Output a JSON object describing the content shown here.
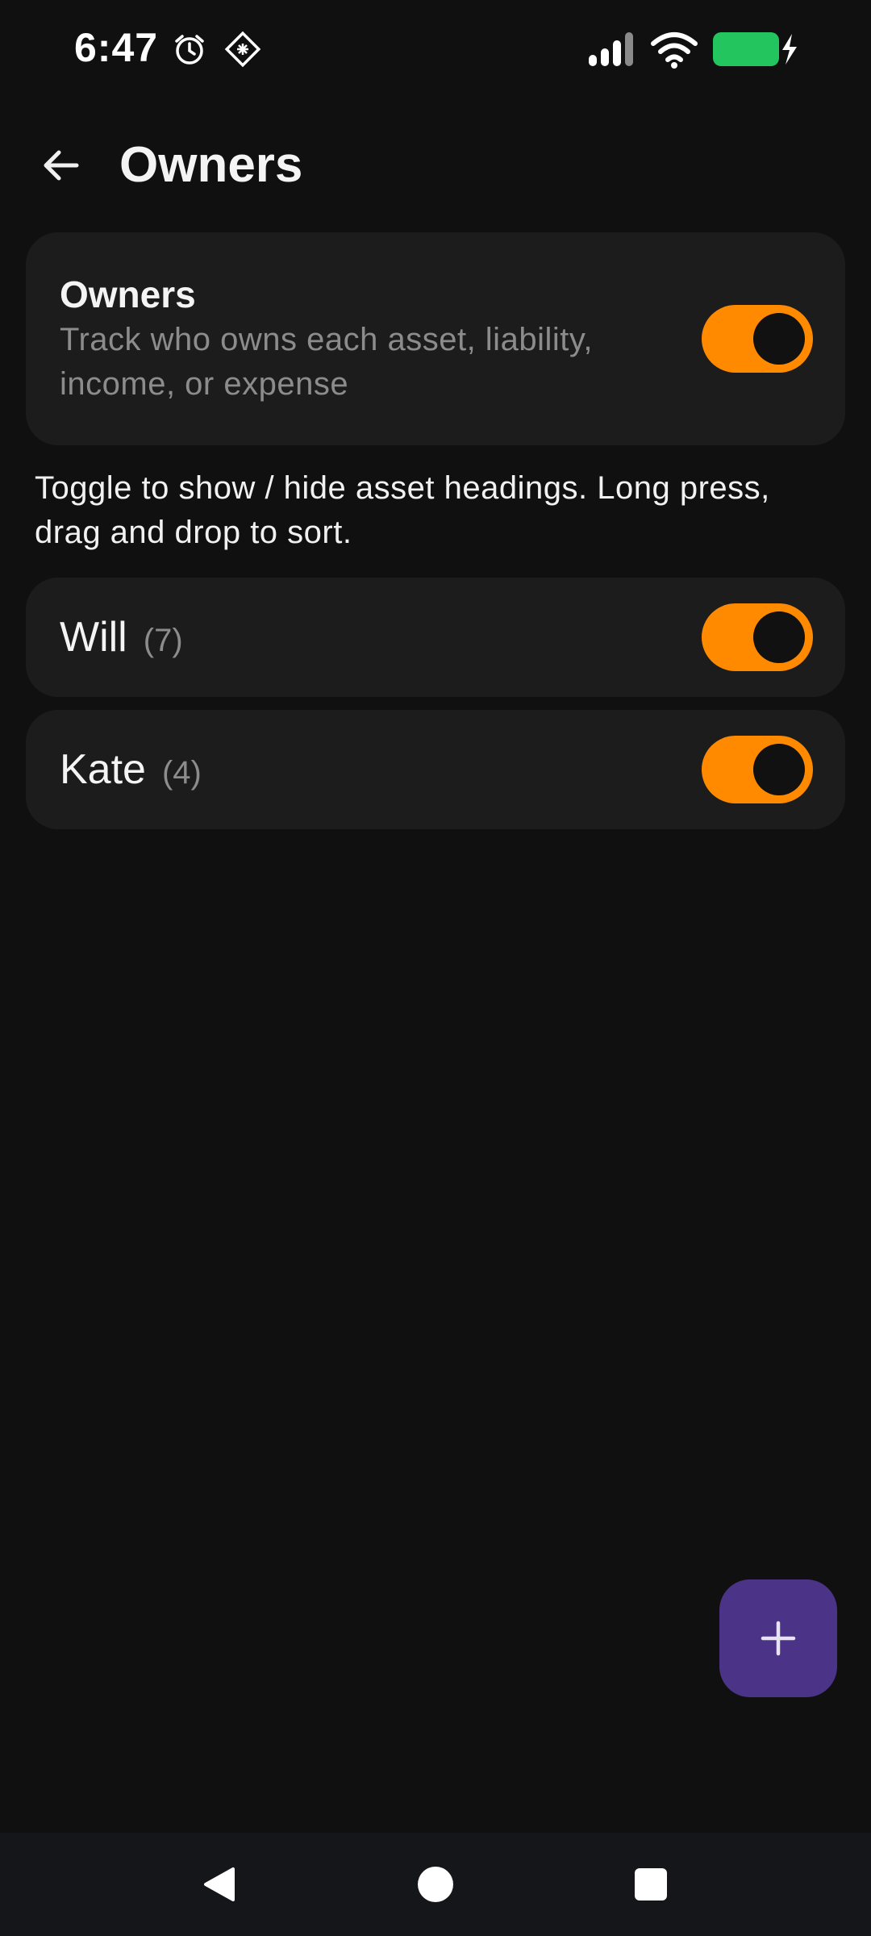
{
  "status_bar": {
    "time": "6:47",
    "icons": [
      "alarm-icon",
      "app-notification-icon",
      "signal-icon",
      "wifi-icon",
      "battery-charging-icon"
    ],
    "battery_color": "#22c55e"
  },
  "app_bar": {
    "back_icon": "arrow-left-icon",
    "title": "Owners"
  },
  "owners_card": {
    "title": "Owners",
    "description": "Track who owns each asset, liability, income, or expense",
    "enabled": true
  },
  "hint": "Toggle to show / hide asset headings. Long press, drag and drop to sort.",
  "owners": [
    {
      "name": "Will",
      "count": "(7)",
      "visible": true
    },
    {
      "name": "Kate",
      "count": "(4)",
      "visible": true
    }
  ],
  "fab": {
    "icon": "plus-icon"
  },
  "nav_bar": {
    "icons": [
      "back-triangle-icon",
      "home-circle-icon",
      "recents-square-icon"
    ]
  },
  "colors": {
    "background": "#101011",
    "card": "#1c1c1d",
    "accent": "#ff8a00",
    "fab": "#4b3487"
  }
}
